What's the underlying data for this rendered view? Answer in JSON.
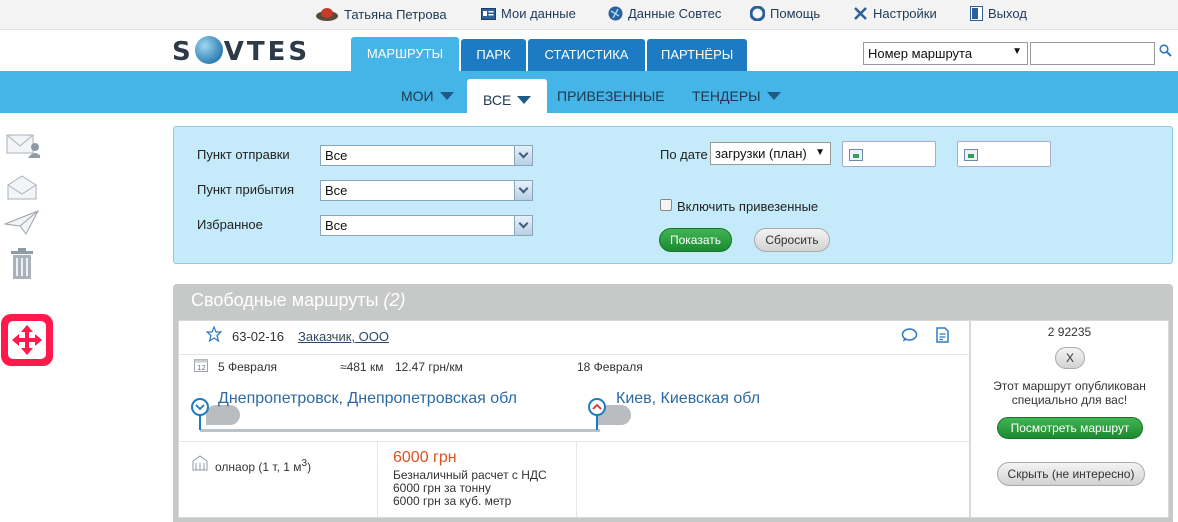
{
  "topbar": {
    "user_name": "Татьяна Петрова",
    "my_data": "Мои данные",
    "sovtes_data": "Данные Совтес",
    "help": "Помощь",
    "settings": "Настройки",
    "logout": "Выход"
  },
  "header": {
    "logo_left": "S",
    "logo_right": "VTES",
    "tabs": [
      "МАРШРУТЫ",
      "ПАРК",
      "СТАТИСТИКА",
      "ПАРТНЁРЫ"
    ],
    "search_select": "Номер маршрута",
    "search_value": ""
  },
  "subnav": {
    "items": [
      "МОИ",
      "ВСЕ",
      "ПРИВЕЗЕННЫЕ",
      "ТЕНДЕРЫ"
    ]
  },
  "filter": {
    "departure_label": "Пункт отправки",
    "departure_value": "Все",
    "arrival_label": "Пункт прибытия",
    "arrival_value": "Все",
    "favorite_label": "Избранное",
    "favorite_value": "Все",
    "by_date_label": "По дате",
    "date_type_value": "загрузки (план)",
    "date_from": "",
    "date_to": "",
    "include_delivered": "Включить привезенные",
    "include_delivered_checked": false,
    "show_button": "Показать",
    "reset_button": "Сбросить"
  },
  "results": {
    "title": "Свободные маршруты",
    "count": "(2)",
    "route": {
      "number": "63-02-16",
      "customer": "Заказчик, ООО",
      "load_date": "5 Февраля",
      "distance": "≈481 км",
      "rate": "12.47 грн/км",
      "unload_date": "18 Февраля",
      "from_city": "Днепропетровск, Днепропетровская обл",
      "to_city": "Киев, Киевская обл",
      "cargo": "олнаор (1 т, 1 м",
      "cargo_sup": "3",
      "cargo_close": ")",
      "price": "6000 грн",
      "payment_type": "Безналичный расчет с НДС",
      "price_per_ton": "6000 грн за тонну",
      "price_per_m3": "6000 грн за куб. метр"
    },
    "side": {
      "id": "2 92235",
      "close": "X",
      "note": "Этот маршрут опубликован специально для вас!",
      "view_button": "Посмотреть маршрут",
      "hide_button": "Скрыть (не интересно)"
    }
  },
  "colors": {
    "accent": "#45b4e6",
    "tab": "#1c7bc3",
    "filter_bg": "#c5eaf9",
    "results_header": "#c7c9c8",
    "price": "#d9531e",
    "badge": "#ff1a4b"
  }
}
